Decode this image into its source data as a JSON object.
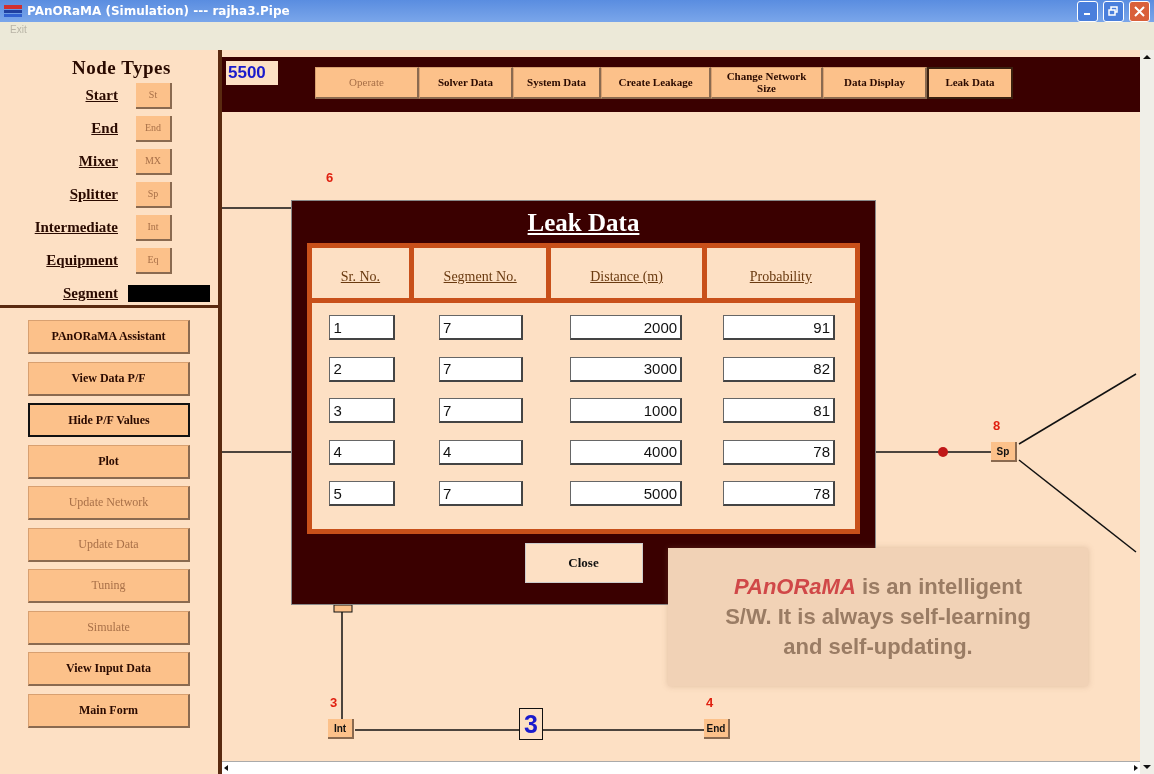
{
  "window": {
    "title": "PAnORaMA (Simulation) --- rajha3.Pipe"
  },
  "menu": [
    {
      "label": "Exit",
      "disabled": true
    }
  ],
  "node_types": {
    "title": "Node Types",
    "items": [
      {
        "label": "Start",
        "button": "St",
        "disabled": true
      },
      {
        "label": "End",
        "button": "End",
        "disabled": true
      },
      {
        "label": "Mixer",
        "button": "MX",
        "disabled": true
      },
      {
        "label": "Splitter",
        "button": "Sp",
        "disabled": true
      },
      {
        "label": "Intermediate",
        "button": "Int",
        "disabled": true
      },
      {
        "label": "Equipment",
        "button": "Eq",
        "disabled": true
      }
    ],
    "segment_label": "Segment"
  },
  "side_buttons": [
    {
      "label": "PAnORaMA Assistant",
      "disabled": false,
      "focused": false
    },
    {
      "label": "View Data P/F",
      "disabled": false,
      "focused": false
    },
    {
      "label": "Hide P/F Values",
      "disabled": false,
      "focused": true
    },
    {
      "label": "Plot",
      "disabled": false,
      "focused": false
    },
    {
      "label": "Update Network",
      "disabled": true,
      "focused": false
    },
    {
      "label": "Update Data",
      "disabled": true,
      "focused": false
    },
    {
      "label": "Tuning",
      "disabled": true,
      "focused": false
    },
    {
      "label": "Simulate",
      "disabled": true,
      "focused": false
    },
    {
      "label": "View Input Data",
      "disabled": false,
      "focused": false
    },
    {
      "label": "Main Form",
      "disabled": false,
      "focused": false
    }
  ],
  "counter": "5500",
  "toolbar": [
    {
      "label": "Operate",
      "disabled": true,
      "focused": false
    },
    {
      "label": "Solver Data",
      "disabled": false,
      "focused": false
    },
    {
      "label": "System Data",
      "disabled": false,
      "focused": false
    },
    {
      "label": "Create Leakage",
      "disabled": false,
      "focused": false
    },
    {
      "label": "Change Network Size",
      "disabled": false,
      "focused": false
    },
    {
      "label": "Data Display",
      "disabled": false,
      "focused": false
    },
    {
      "label": "Leak Data",
      "disabled": false,
      "focused": true
    }
  ],
  "canvas": {
    "node_numbers": [
      {
        "number": "6"
      }
    ],
    "nodes": [
      {
        "number": "8",
        "label": "Sp"
      },
      {
        "number": "3",
        "label": "Int"
      },
      {
        "number": "4",
        "label": "End"
      }
    ],
    "segment_label": "3"
  },
  "dialog": {
    "title": "Leak Data",
    "columns": [
      "Sr. No.",
      "Segment No.",
      "Distance (m)",
      "Probability"
    ],
    "rows": [
      [
        "1",
        "7",
        "2000",
        "91"
      ],
      [
        "2",
        "7",
        "3000",
        "82"
      ],
      [
        "3",
        "7",
        "1000",
        "81"
      ],
      [
        "4",
        "4",
        "4000",
        "78"
      ],
      [
        "5",
        "7",
        "5000",
        "78"
      ]
    ],
    "close_button": "Close"
  },
  "tooltip": {
    "brand": "PAnORaMA",
    "text": "is an intelligent S/W. It is always self-learning and self-updating."
  }
}
